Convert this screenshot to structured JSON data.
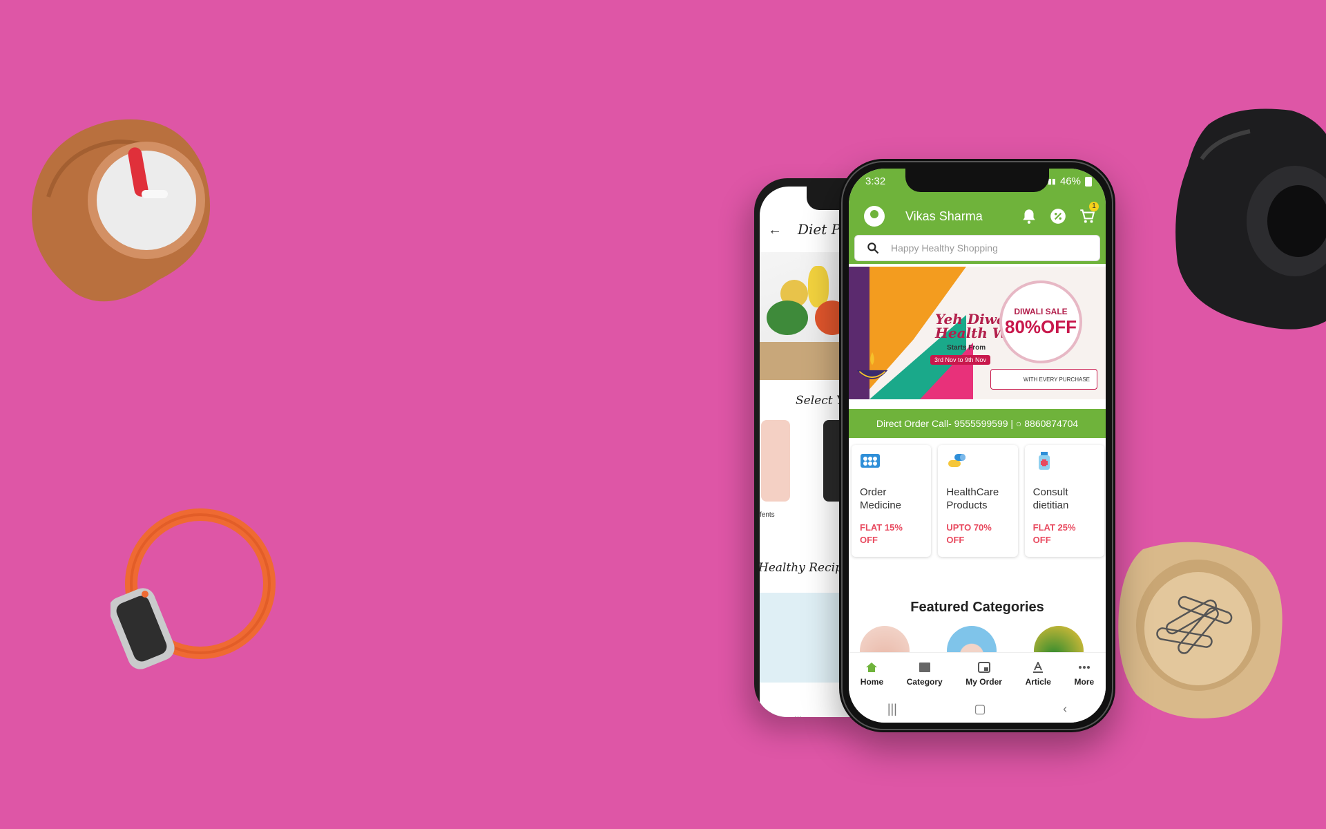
{
  "background_color": "#de56a6",
  "back_screen": {
    "title": "Diet Plan",
    "section_select": "Select You",
    "card_caption": "fents",
    "section_recipes": "Healthy Recipes Fo"
  },
  "status_bar": {
    "time": "3:32",
    "battery": "46%"
  },
  "header": {
    "username": "Vikas Sharma",
    "cart_count": "1",
    "accent_color": "#6fb33b"
  },
  "search": {
    "placeholder": "Happy Healthy Shopping"
  },
  "banner": {
    "headline_line1": "Yeh Diwali",
    "headline_line2": "Health Wali",
    "starts_from": "Starts From",
    "date_range": "3rd Nov to 9th Nov",
    "sale_label": "DIWALI SALE",
    "sale_value": "80%OFF",
    "offer_text": "WITH EVERY PURCHASE"
  },
  "direct_order": "Direct Order Call- 9555599599 | ○ 8860874704",
  "service_cards": [
    {
      "icon": "pills-blister-icon",
      "title_line1": "Order",
      "title_line2": "Medicine",
      "offer_line1": "FLAT 15%",
      "offer_line2": "OFF"
    },
    {
      "icon": "capsules-icon",
      "title_line1": "HealthCare",
      "title_line2": "Products",
      "offer_line1": "UPTO 70%",
      "offer_line2": "OFF"
    },
    {
      "icon": "medicine-bottle-icon",
      "title_line1": "Consult",
      "title_line2": "dietitian",
      "offer_line1": "FLAT 25%",
      "offer_line2": "OFF"
    }
  ],
  "featured_title": "Featured Categories",
  "bottom_nav": [
    {
      "label": "Home",
      "icon": "home-icon"
    },
    {
      "label": "Category",
      "icon": "category-icon"
    },
    {
      "label": "My Order",
      "icon": "my-order-icon"
    },
    {
      "label": "Article",
      "icon": "article-icon"
    },
    {
      "label": "More",
      "icon": "more-dots-icon"
    }
  ],
  "system_nav": {
    "recents": "|||",
    "home": "▢",
    "back": "‹"
  }
}
